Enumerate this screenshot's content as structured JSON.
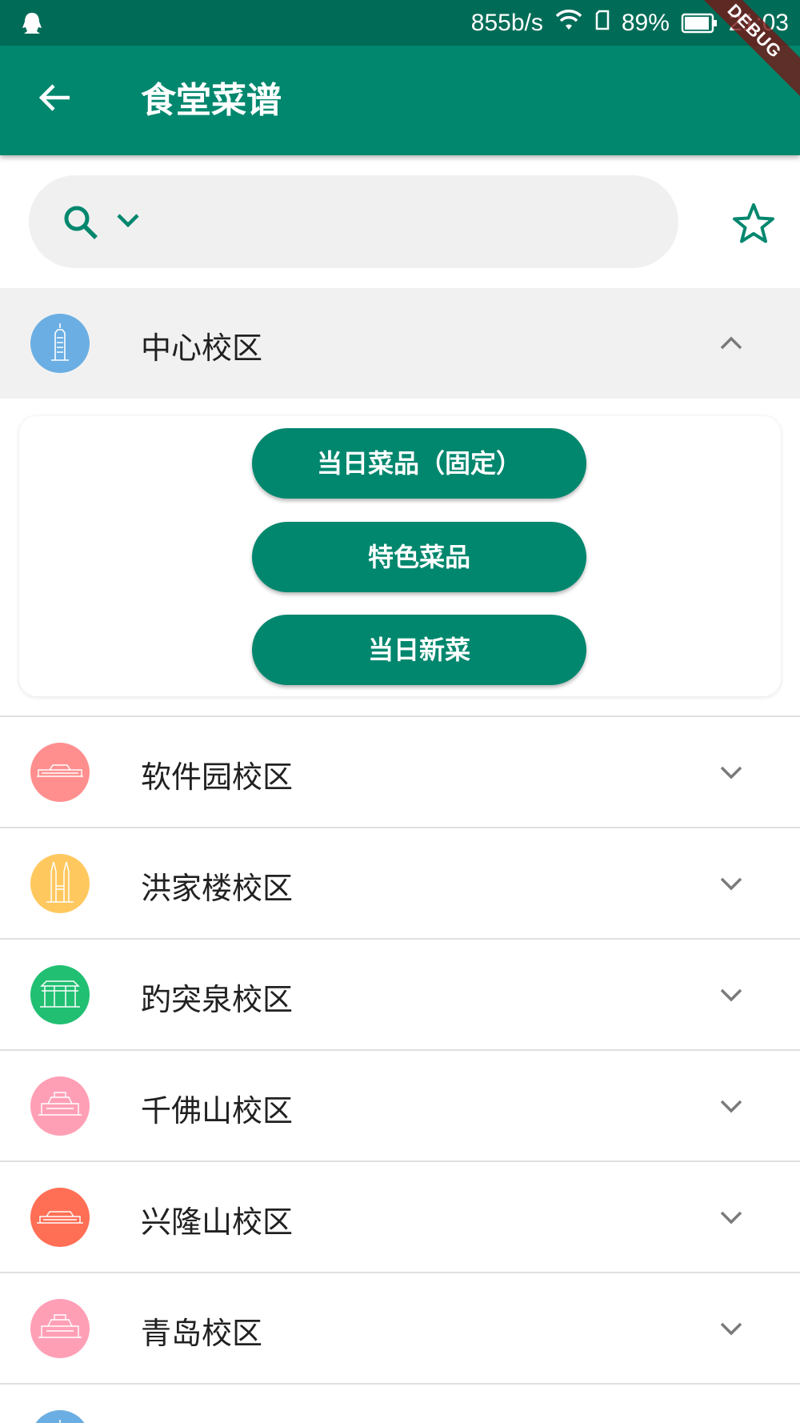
{
  "status_bar": {
    "net_speed": "855b/s",
    "battery": "89%",
    "time": "21:03",
    "debug": "DEBUG"
  },
  "app_bar": {
    "title": "食堂菜谱"
  },
  "search": {
    "placeholder": ""
  },
  "colors": {
    "primary": "#00876e",
    "status_bar": "#006c57"
  },
  "expanded_campus": {
    "name": "中心校区",
    "icon": "skyscraper-icon",
    "color": "#6aaee3",
    "buttons": [
      "当日菜品（固定）",
      "特色菜品",
      "当日新菜"
    ]
  },
  "campuses": [
    {
      "name": "软件园校区",
      "icon": "building-icon",
      "color": "#ff8f8f"
    },
    {
      "name": "洪家楼校区",
      "icon": "church-icon",
      "color": "#ffc85f"
    },
    {
      "name": "趵突泉校区",
      "icon": "gate-icon",
      "color": "#21bf72"
    },
    {
      "name": "千佛山校区",
      "icon": "hall-icon",
      "color": "#ff9fb6"
    },
    {
      "name": "兴隆山校区",
      "icon": "building-icon",
      "color": "#ff6f56"
    },
    {
      "name": "青岛校区",
      "icon": "hall-icon",
      "color": "#ff9fb6"
    }
  ],
  "partial_campus": {
    "icon": "skyscraper-icon",
    "color": "#6aaee3"
  }
}
